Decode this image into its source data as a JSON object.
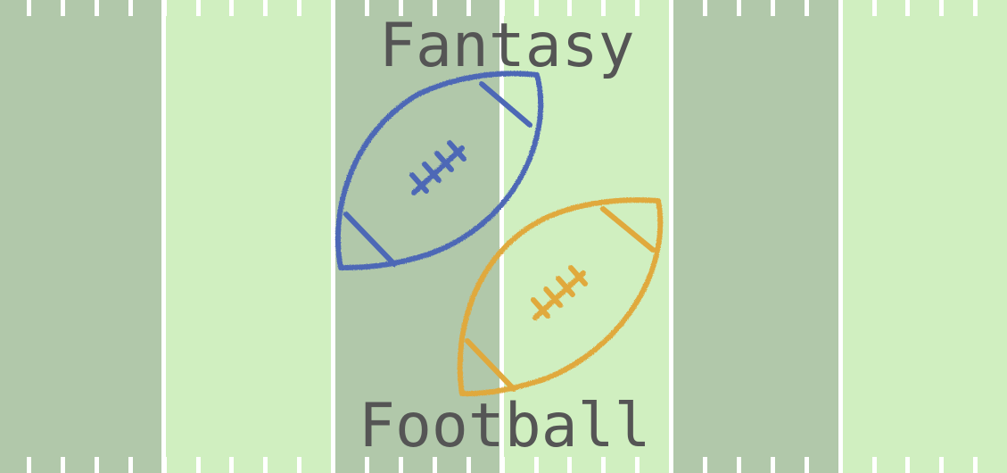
{
  "logo": {
    "line1": "Fantasy",
    "line2": "Football"
  },
  "colors": {
    "field_dark": "#b1c8aa",
    "field_light": "#d0efc0",
    "field_lines": "#ffffff",
    "ball_blue": "#4e68b6",
    "ball_gold": "#e0a93c",
    "text": "#555555"
  },
  "icons": [
    "football-field",
    "football-icon-blue",
    "football-icon-gold"
  ]
}
